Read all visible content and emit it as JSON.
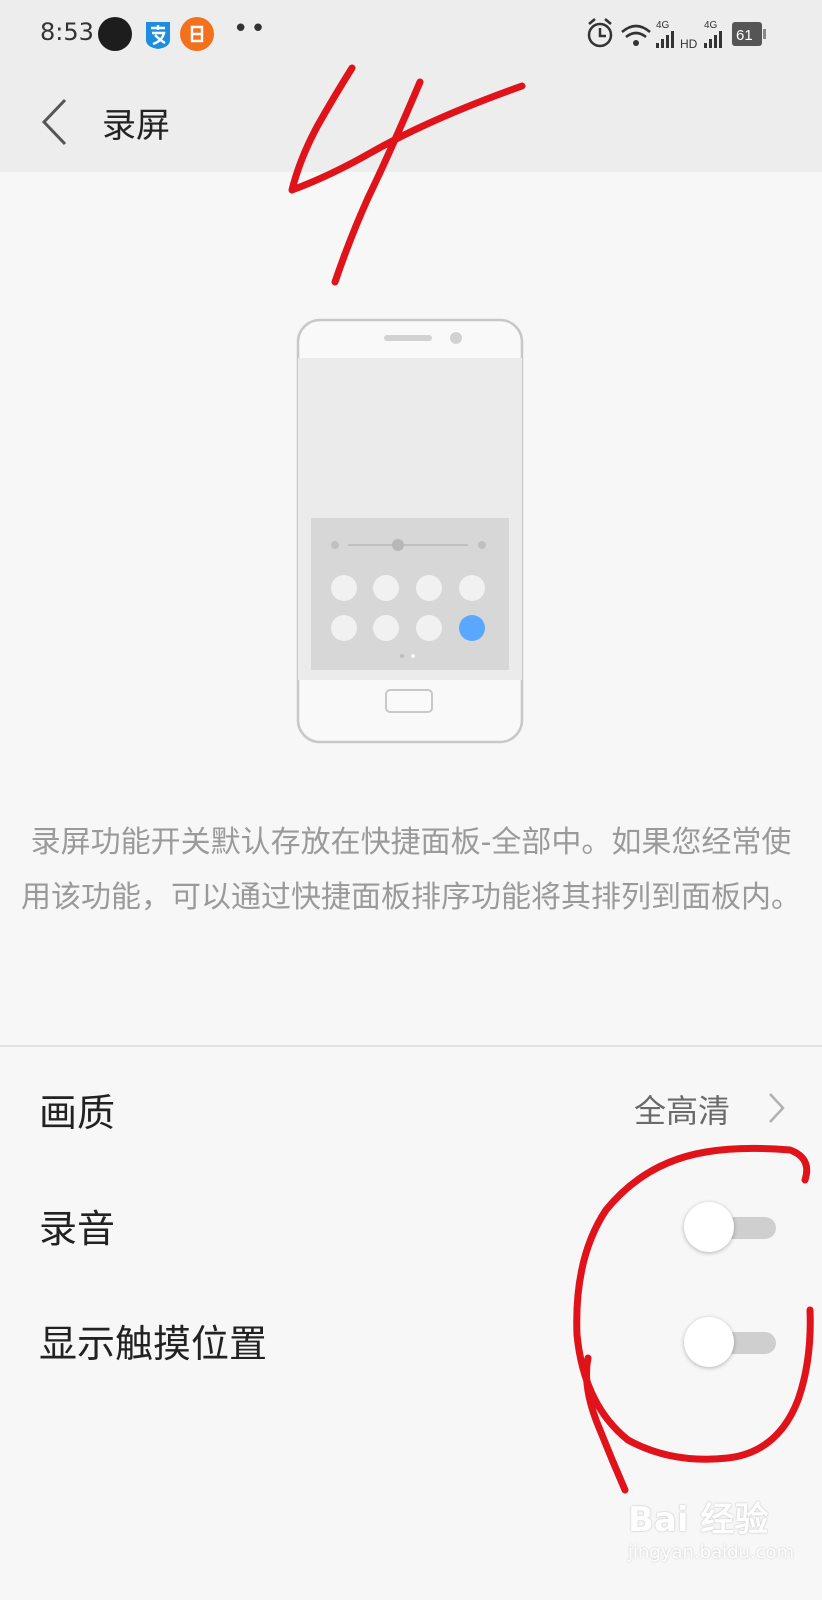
{
  "status_bar": {
    "time": "8:53",
    "network_1": "4G",
    "network_2": "4G",
    "hd": "HD",
    "battery": "61",
    "icons": [
      "dot-app-icon",
      "alipay-icon",
      "orange-app-icon",
      "more-dots-icon",
      "alarm-icon",
      "wifi-icon",
      "signal-icon",
      "battery-icon"
    ]
  },
  "header": {
    "title": "录屏"
  },
  "illustration": {
    "subject": "phone-quick-panel",
    "highlight_color": "#5aa7ff"
  },
  "description": "录屏功能开关默认存放在快捷面板-全部中。如果您经常使用该功能，可以通过快捷面板排序功能将其排列到面板内。",
  "settings": {
    "quality": {
      "label": "画质",
      "value": "全高清"
    },
    "audio": {
      "label": "录音",
      "enabled": false
    },
    "touch": {
      "label": "显示触摸位置",
      "enabled": false
    }
  },
  "annotation": {
    "handwritten": "4",
    "color": "#e0131a"
  },
  "watermark": {
    "logo": "Bai 经验",
    "url": "jingyan.baidu.com"
  }
}
